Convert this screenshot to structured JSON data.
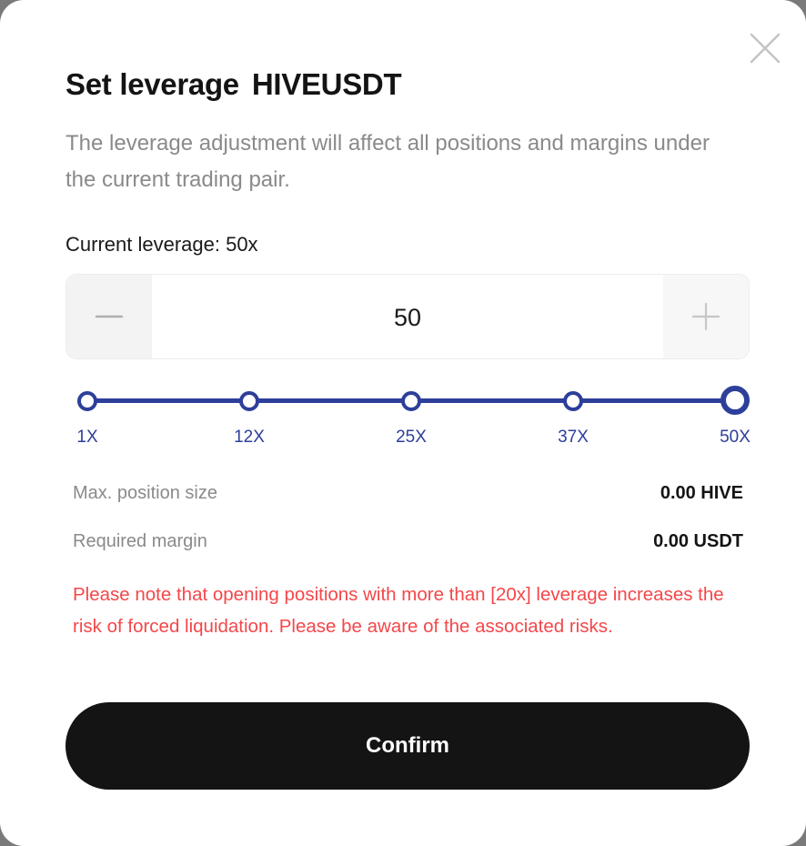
{
  "dialog": {
    "title": "Set leverage",
    "pair": "HIVEUSDT",
    "description": "The leverage adjustment will affect all positions and margins under the current trading pair.",
    "current_leverage": "Current leverage: 50x",
    "close_icon": "close-icon"
  },
  "stepper": {
    "value": "50",
    "minus_icon": "minus-icon",
    "plus_icon": "plus-icon"
  },
  "slider": {
    "marks": [
      "1X",
      "12X",
      "25X",
      "37X",
      "50X"
    ],
    "selected": "50X",
    "color": "#2d3f9a"
  },
  "info": {
    "max_position_label": "Max. position size",
    "max_position_value": "0.00 HIVE",
    "required_margin_label": "Required margin",
    "required_margin_value": "0.00 USDT"
  },
  "warning": "Please note that opening positions with more than [20x] leverage increases the risk of forced liquidation. Please be aware of the associated risks.",
  "confirm_label": "Confirm",
  "colors": {
    "accent": "#2d3f9a",
    "warning": "#f4474a",
    "button": "#141414"
  }
}
